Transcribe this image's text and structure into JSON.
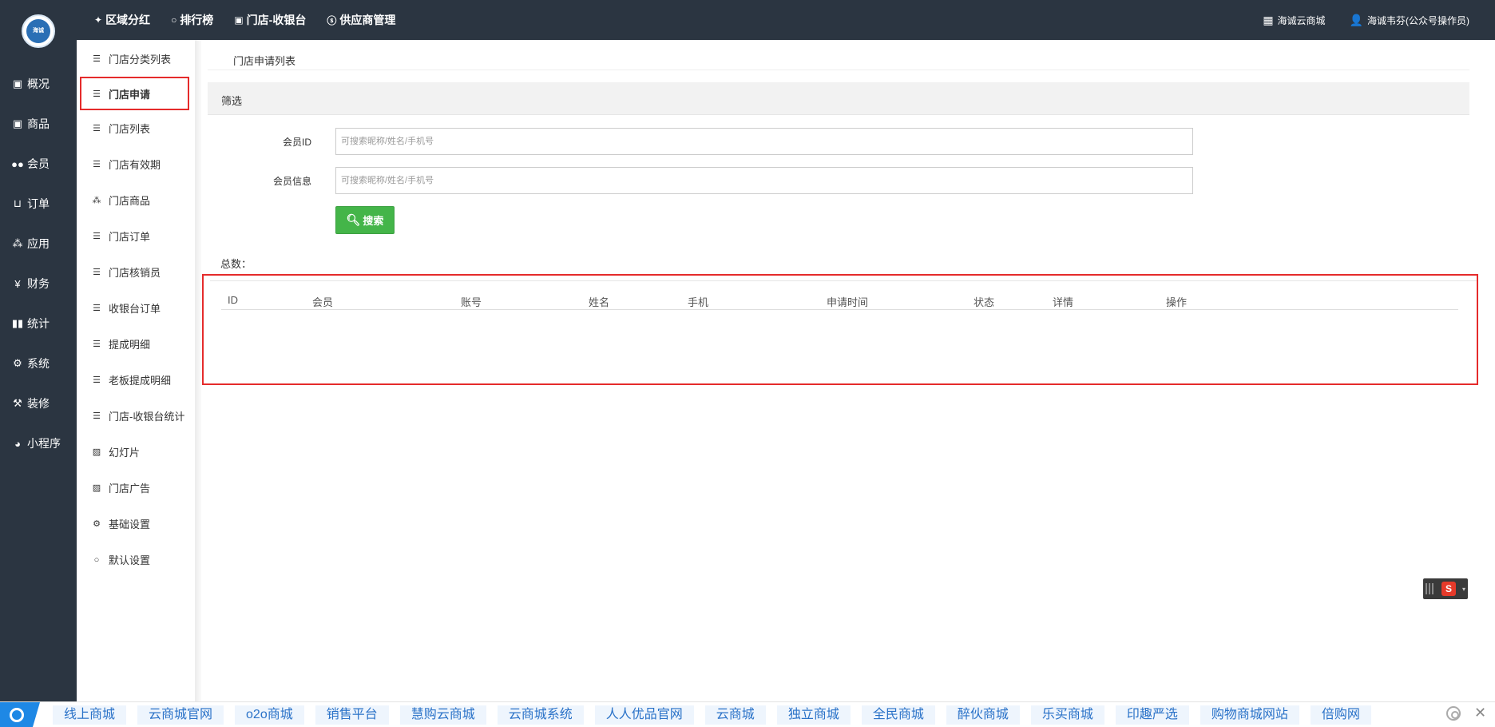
{
  "logo": {
    "text": "海诚",
    "icon": "store-logo"
  },
  "topnav": [
    {
      "label": "区域分红",
      "icon": "pin-icon"
    },
    {
      "label": "排行榜",
      "icon": "circle-icon"
    },
    {
      "label": "门店-收银台",
      "icon": "money-icon"
    },
    {
      "label": "供应商管理",
      "icon": "skype-icon"
    }
  ],
  "topright": {
    "shop": {
      "label": "海诚云商城",
      "icon": "grid-icon"
    },
    "user": {
      "label": "海诚韦芬(公众号操作员)",
      "icon": "user-icon"
    }
  },
  "mainnav": [
    {
      "label": "概况",
      "icon": "panel-icon"
    },
    {
      "label": "商品",
      "icon": "panel-icon"
    },
    {
      "label": "会员",
      "icon": "users-icon"
    },
    {
      "label": "订单",
      "icon": "cart-icon"
    },
    {
      "label": "应用",
      "icon": "cubes-icon"
    },
    {
      "label": "财务",
      "icon": "yen-icon"
    },
    {
      "label": "统计",
      "icon": "bar-chart-icon"
    },
    {
      "label": "系统",
      "icon": "cogs-icon"
    },
    {
      "label": "装修",
      "icon": "gavel-icon"
    },
    {
      "label": "小程序",
      "icon": "wechat-icon"
    }
  ],
  "submenu": [
    {
      "label": "门店分类列表",
      "icon": "list-icon",
      "active": false
    },
    {
      "label": "门店申请",
      "icon": "list-icon",
      "active": true
    },
    {
      "label": "门店列表",
      "icon": "list-icon",
      "active": false
    },
    {
      "label": "门店有效期",
      "icon": "list-icon",
      "active": false
    },
    {
      "label": "门店商品",
      "icon": "cubes-icon",
      "active": false
    },
    {
      "label": "门店订单",
      "icon": "list-icon",
      "active": false
    },
    {
      "label": "门店核销员",
      "icon": "list-icon",
      "active": false
    },
    {
      "label": "收银台订单",
      "icon": "list-icon",
      "active": false
    },
    {
      "label": "提成明细",
      "icon": "list-icon",
      "active": false
    },
    {
      "label": "老板提成明细",
      "icon": "list-icon",
      "active": false
    },
    {
      "label": "门店-收银台统计",
      "icon": "list-icon",
      "active": false
    },
    {
      "label": "幻灯片",
      "icon": "image-icon",
      "active": false
    },
    {
      "label": "门店广告",
      "icon": "image-icon",
      "active": false
    },
    {
      "label": "基础设置",
      "icon": "cogs-icon",
      "active": false
    },
    {
      "label": "默认设置",
      "icon": "circle-icon",
      "active": false
    }
  ],
  "page": {
    "title": "门店申请列表",
    "filter_title": "筛选",
    "member_id_label": "会员ID",
    "member_id_placeholder": "可搜索昵称/姓名/手机号",
    "member_info_label": "会员信息",
    "member_info_placeholder": "可搜索昵称/姓名/手机号",
    "search_label": "搜索",
    "total_label": "总数：",
    "columns": [
      "ID",
      "会员",
      "账号",
      "姓名",
      "手机",
      "申请时间",
      "状态",
      "详情",
      "操作"
    ]
  },
  "bottom_links": [
    "线上商城",
    "云商城官网",
    "o2o商城",
    "销售平台",
    "慧购云商城",
    "云商城系统",
    "人人优品官网",
    "云商城",
    "独立商城",
    "全民商城",
    "醉伙商城",
    "乐买商城",
    "印趣严选",
    "购物商城网站",
    "倍购网"
  ],
  "colors": {
    "sidebar": "#2b3541",
    "accent_red": "#e52b2b",
    "search_green": "#44b549",
    "link_blue": "#2a72c8"
  }
}
